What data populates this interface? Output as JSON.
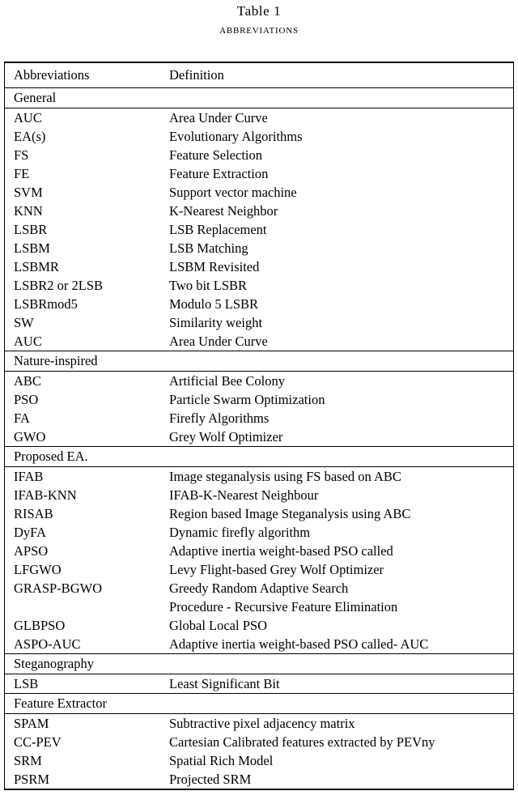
{
  "caption": {
    "table_number": "Table 1",
    "title": "Abbreviations"
  },
  "table": {
    "columns": [
      "Abbreviations",
      "Definition"
    ],
    "sections": [
      {
        "heading": "General",
        "rows": [
          {
            "abbr": "AUC",
            "definition": "Area Under Curve"
          },
          {
            "abbr": "EA(s)",
            "definition": "Evolutionary Algorithms"
          },
          {
            "abbr": "FS",
            "definition": "Feature Selection"
          },
          {
            "abbr": "FE",
            "definition": "Feature Extraction"
          },
          {
            "abbr": "SVM",
            "definition": "Support vector machine"
          },
          {
            "abbr": "KNN",
            "definition": "K-Nearest Neighbor"
          },
          {
            "abbr": "LSBR",
            "definition": "LSB Replacement"
          },
          {
            "abbr": "LSBM",
            "definition": "LSB Matching"
          },
          {
            "abbr": "LSBMR",
            "definition": "LSBM Revisited"
          },
          {
            "abbr": "LSBR2 or 2LSB",
            "definition": "Two bit LSBR"
          },
          {
            "abbr": "LSBRmod5",
            "definition": "Modulo 5 LSBR"
          },
          {
            "abbr": "SW",
            "definition": "Similarity weight"
          },
          {
            "abbr": "AUC",
            "definition": "Area Under Curve"
          }
        ]
      },
      {
        "heading": "Nature-inspired",
        "rows": [
          {
            "abbr": "ABC",
            "definition": "Artificial Bee Colony"
          },
          {
            "abbr": "PSO",
            "definition": "Particle Swarm Optimization"
          },
          {
            "abbr": "FA",
            "definition": "Firefly Algorithms"
          },
          {
            "abbr": "GWO",
            "definition": "Grey Wolf Optimizer"
          }
        ]
      },
      {
        "heading": "Proposed EA.",
        "rows": [
          {
            "abbr": "IFAB",
            "definition": "Image steganalysis using FS based on ABC"
          },
          {
            "abbr": "IFAB-KNN",
            "definition": "IFAB-K-Nearest Neighbour"
          },
          {
            "abbr": "RISAB",
            "definition": "Region based Image Steganalysis using ABC"
          },
          {
            "abbr": "DyFA",
            "definition": "Dynamic firefly algorithm"
          },
          {
            "abbr": "APSO",
            "definition": "Adaptive inertia weight-based PSO called"
          },
          {
            "abbr": "LFGWO",
            "definition": "Levy Flight-based Grey Wolf Optimizer"
          },
          {
            "abbr": "GRASP-BGWO",
            "definition": "Greedy Random Adaptive Search"
          },
          {
            "abbr": "",
            "definition": "Procedure - Recursive Feature Elimination"
          },
          {
            "abbr": "GLBPSO",
            "definition": "Global Local PSO"
          },
          {
            "abbr": "ASPO-AUC",
            "definition": "Adaptive inertia weight-based PSO called- AUC"
          }
        ]
      },
      {
        "heading": "Steganography",
        "rows": [
          {
            "abbr": "LSB",
            "definition": "Least Significant Bit"
          }
        ]
      },
      {
        "heading": "Feature Extractor",
        "rows": [
          {
            "abbr": "SPAM",
            "definition": "Subtractive pixel adjacency matrix"
          },
          {
            "abbr": "CC-PEV",
            "definition": "Cartesian Calibrated features extracted by PEVny"
          },
          {
            "abbr": "SRM",
            "definition": "Spatial Rich Model"
          },
          {
            "abbr": "PSRM",
            "definition": "Projected SRM"
          }
        ]
      }
    ]
  }
}
